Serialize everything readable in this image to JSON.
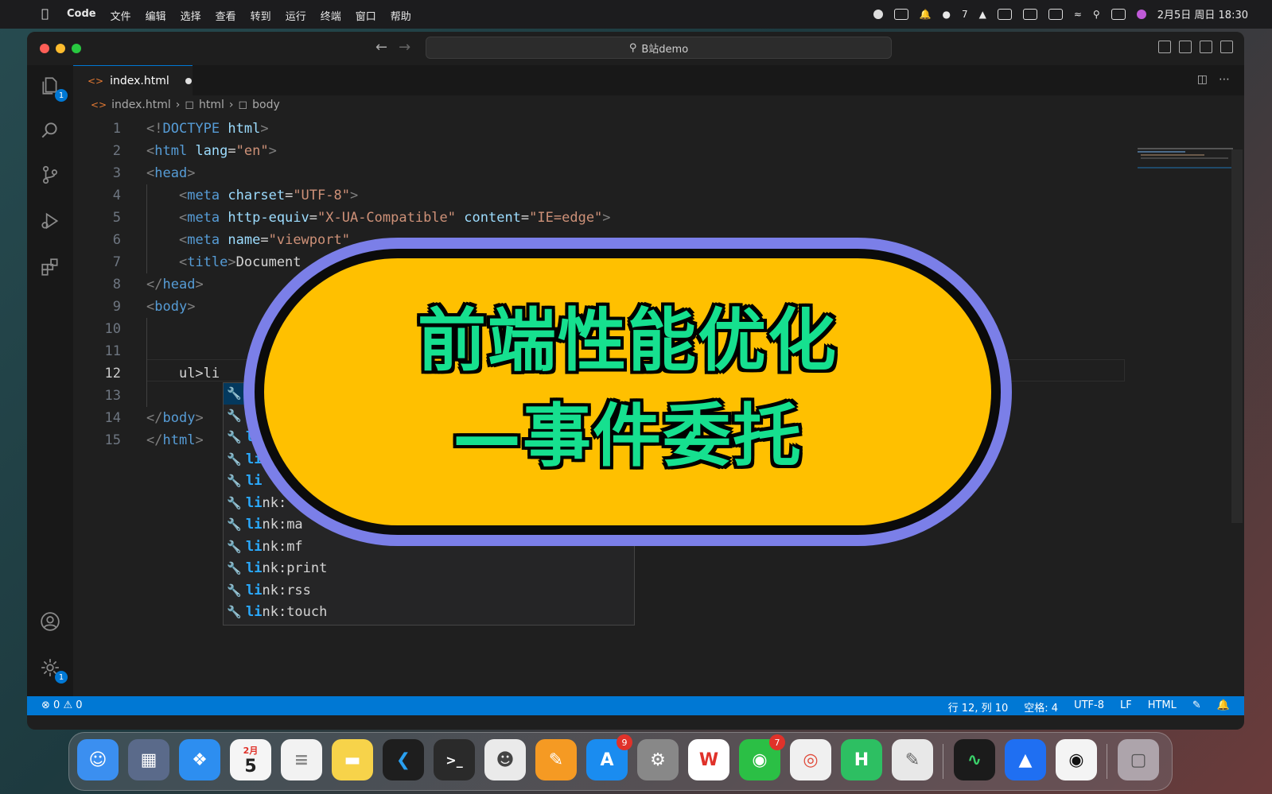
{
  "menubar": {
    "app": "Code",
    "menus": [
      "文件",
      "编辑",
      "选择",
      "查看",
      "转到",
      "运行",
      "终端",
      "窗口",
      "帮助"
    ],
    "wechat_count": "7",
    "clock": "2月5日 周日 18:30"
  },
  "titlebar": {
    "search": "B站demo"
  },
  "activity": {
    "explorer_badge": "1",
    "settings_badge": "1"
  },
  "tab": {
    "filename": "index.html"
  },
  "breadcrumb": [
    "index.html",
    "html",
    "body"
  ],
  "editor": {
    "line_numbers": [
      "1",
      "2",
      "3",
      "4",
      "5",
      "6",
      "7",
      "8",
      "9",
      "10",
      "11",
      "12",
      "13",
      "14",
      "15"
    ],
    "current_line_text": "ul>li"
  },
  "suggestions": [
    {
      "match": "li",
      "rest": ""
    },
    {
      "match": "li",
      "rest": ""
    },
    {
      "match": "li",
      "rest": ""
    },
    {
      "match": "li",
      "rest": ""
    },
    {
      "match": "li",
      "rest": ""
    },
    {
      "match": "li",
      "rest": "nk:"
    },
    {
      "match": "li",
      "rest": "nk:ma"
    },
    {
      "match": "li",
      "rest": "nk:mf"
    },
    {
      "match": "li",
      "rest": "nk:print"
    },
    {
      "match": "li",
      "rest": "nk:rss"
    },
    {
      "match": "li",
      "rest": "nk:touch"
    }
  ],
  "statusbar": {
    "errors": "0",
    "warnings": "0",
    "position": "行 12, 列 10",
    "spaces": "空格: 4",
    "encoding": "UTF-8",
    "eol": "LF",
    "language": "HTML"
  },
  "overlay": {
    "title": "前端性能优化",
    "subtitle": "—事件委托"
  },
  "dock": {
    "calendar_month": "2月",
    "calendar_day": "5",
    "appstore_badge": "9",
    "wechat_badge": "7"
  },
  "colors": {
    "accent": "#0078d4",
    "overlay_fill": "#ffc000",
    "overlay_border": "#7b7fe8",
    "overlay_text": "#16e08f"
  }
}
